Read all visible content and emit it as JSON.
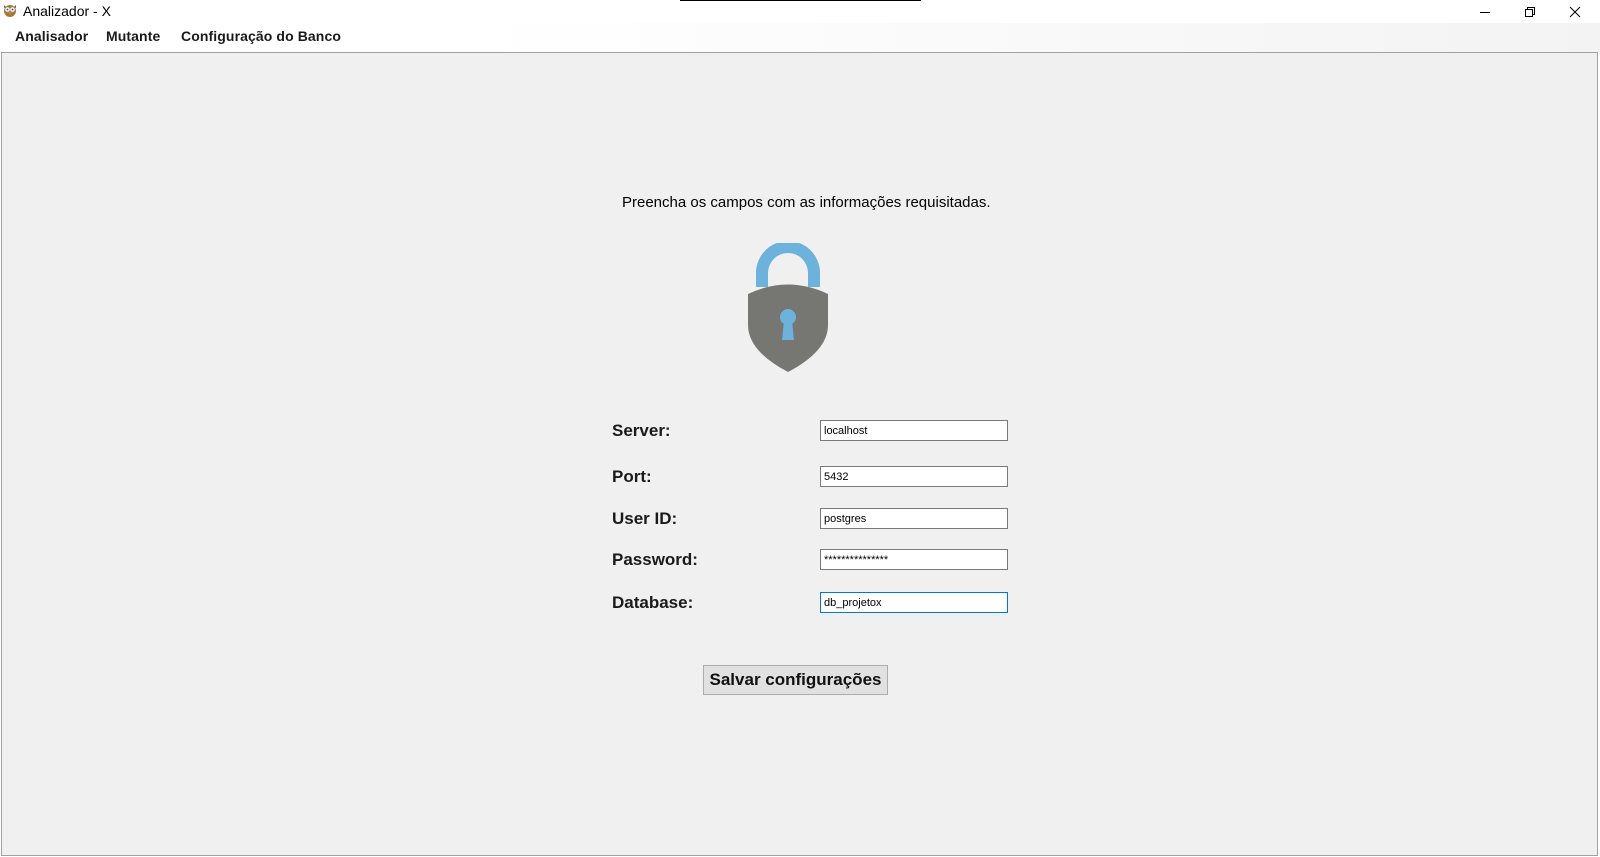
{
  "window": {
    "title": "Analizador - X",
    "app_icon": "owl-icon",
    "controls": [
      "minimize-icon",
      "restore-icon",
      "close-icon"
    ]
  },
  "menu": {
    "items": [
      {
        "label": "Analisador"
      },
      {
        "label": "Mutante"
      },
      {
        "label": "Configuração do Banco"
      }
    ]
  },
  "form": {
    "instruction": "Preencha os campos com as informações requisitadas.",
    "icon": "lock-icon",
    "fields": [
      {
        "label": "Server:",
        "value": "localhost"
      },
      {
        "label": "Port:",
        "value": "5432"
      },
      {
        "label": "User ID:",
        "value": "postgres"
      },
      {
        "label": "Password:",
        "value": "***************"
      },
      {
        "label": "Database:",
        "value": "db_projetox"
      }
    ],
    "save_label": "Salvar configurações"
  },
  "colors": {
    "lock_shackle": "#6cb2dc",
    "lock_body": "#767673",
    "focus_border": "#0078d7",
    "client_bg": "#f0f0f0"
  }
}
